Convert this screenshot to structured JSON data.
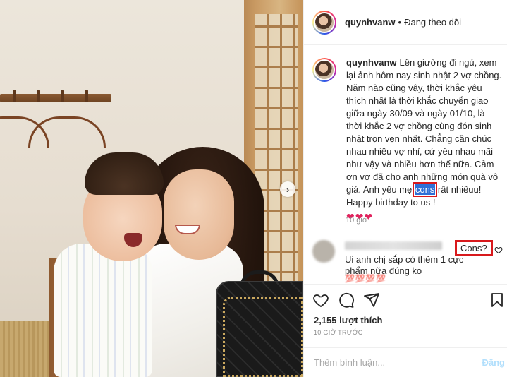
{
  "post": {
    "author": {
      "username": "quynhvanw",
      "follow_status": "Đang theo dõi",
      "separator": "•"
    },
    "caption": {
      "username": "quynhvanw",
      "text_before": "Lên giường đi ngủ, xem lại ảnh hôm nay sinh nhật 2 vợ chồng. Năm nào cũng vậy, thời khắc yêu thích nhất là thời khắc chuyển giao giữa ngày 30/09 và ngày 01/10, là thời khắc 2 vợ chồng cùng đón sinh nhật trọn vẹn nhất. Chẳng cần chúc nhau nhiều vợ nhỉ, cứ yêu nhau mãi như vậy và nhiều hơn thế nữa. Cảm ơn vợ đã cho anh những món quà vô giá. Anh yêu mẹ ",
      "highlighted_word": "cons",
      "text_after": " rất nhiềuu! Happy birthday to us !",
      "hearts": "❤❤❤"
    },
    "time_ago": "10 giờ",
    "likes": "2,155 lượt thích",
    "posted_time": "10 GIỜ TRƯỚC"
  },
  "comment": {
    "text": "Ui anh chị sắp có thêm 1 cực phẩm nữa đúng ko",
    "badge": "Cons?",
    "emojis": "💯💯💯💯"
  },
  "comment_box": {
    "placeholder": "Thêm bình luận...",
    "post_label": "Đăng"
  },
  "photo": {
    "next_arrow": "›"
  },
  "colors": {
    "like_heart": "#e0245e",
    "highlight": "#2f6fd6",
    "annotation_box": "#d8191c",
    "post_button": "#b2dffc"
  },
  "icons": [
    "heart-icon",
    "comment-icon",
    "share-icon",
    "bookmark-icon",
    "small-heart-icon",
    "chevron-right-icon"
  ]
}
